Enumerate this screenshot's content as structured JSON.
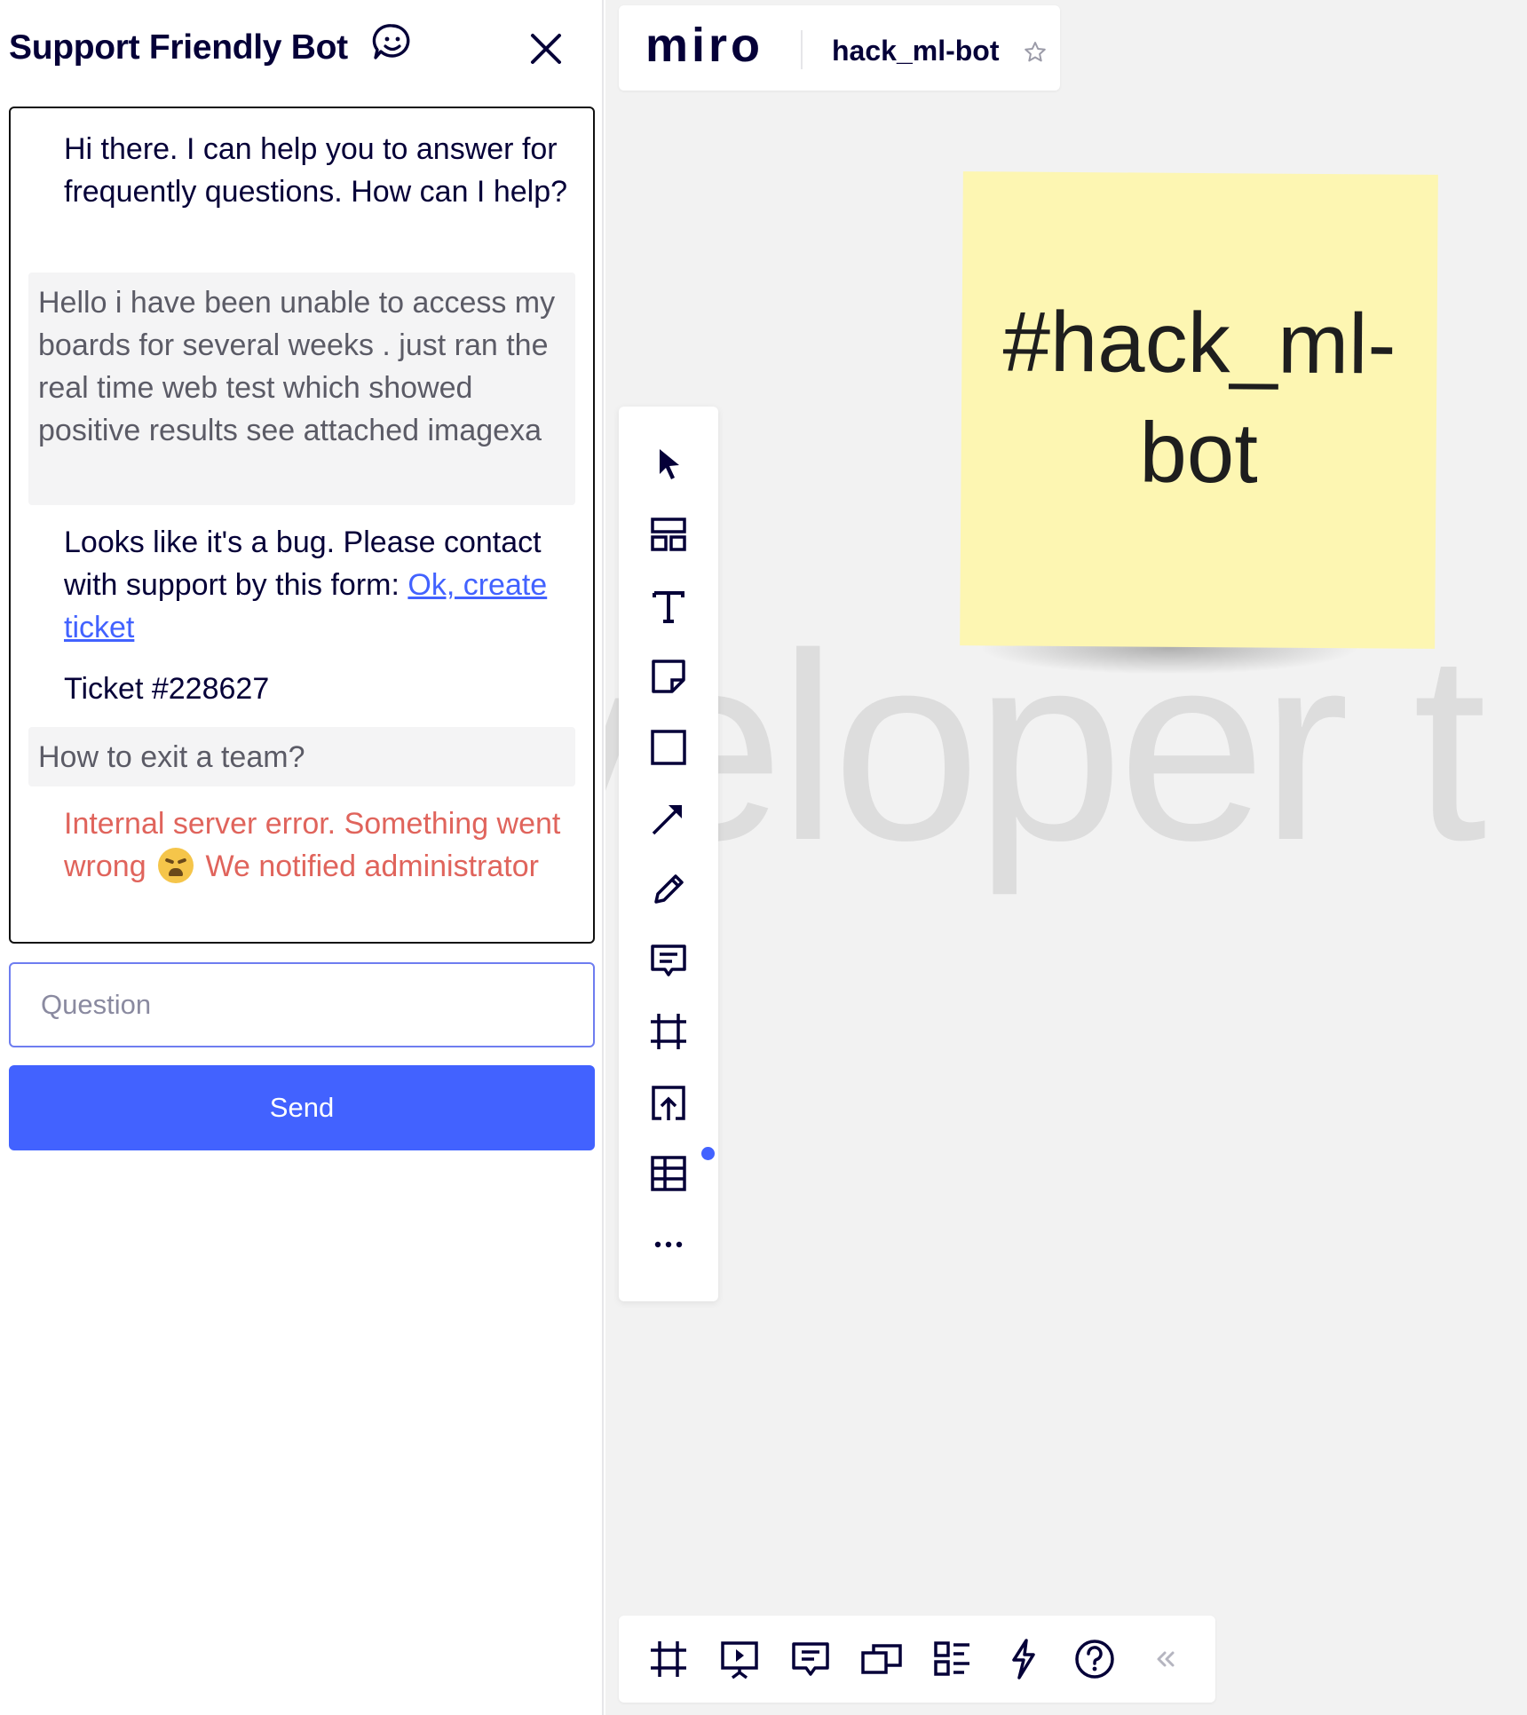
{
  "chat": {
    "title": "Support Friendly Bot",
    "messages": {
      "greeting": "Hi there. I can help you to answer for frequently questions. How can I help?",
      "user_issue": "Hello i have been unable to access my boards for several weeks . just ran the real time web test which showed positive results see attached imagexa",
      "bug_reply_prefix": "Looks like it's a bug. Please contact with support by this form: ",
      "bug_reply_link": "Ok, create ticket",
      "ticket": "Ticket #228627",
      "user_question": "How to exit a team?",
      "error_part1": "Internal server error. Something went wrong",
      "error_part2": " We notified administrator"
    },
    "input_placeholder": "Question",
    "input_value": "",
    "send_label": "Send"
  },
  "miro": {
    "logo": "miro",
    "board_name": "hack_ml-bot",
    "sticky_text": "#hack_ml-bot",
    "background_text": "veloper t"
  },
  "toolbar": [
    "select",
    "templates",
    "text",
    "sticky-note",
    "shape",
    "connection-line",
    "pen",
    "comment",
    "frame",
    "upload",
    "table",
    "more"
  ],
  "bottom_toolbar": [
    "frames",
    "presentation",
    "comments",
    "card",
    "kanban",
    "integrations",
    "help",
    "collapse"
  ],
  "colors": {
    "accent": "#4262ff",
    "error": "#e0645c",
    "sticky": "#fdf6b2",
    "canvas": "#f2f2f2",
    "text_dark": "#050038"
  }
}
